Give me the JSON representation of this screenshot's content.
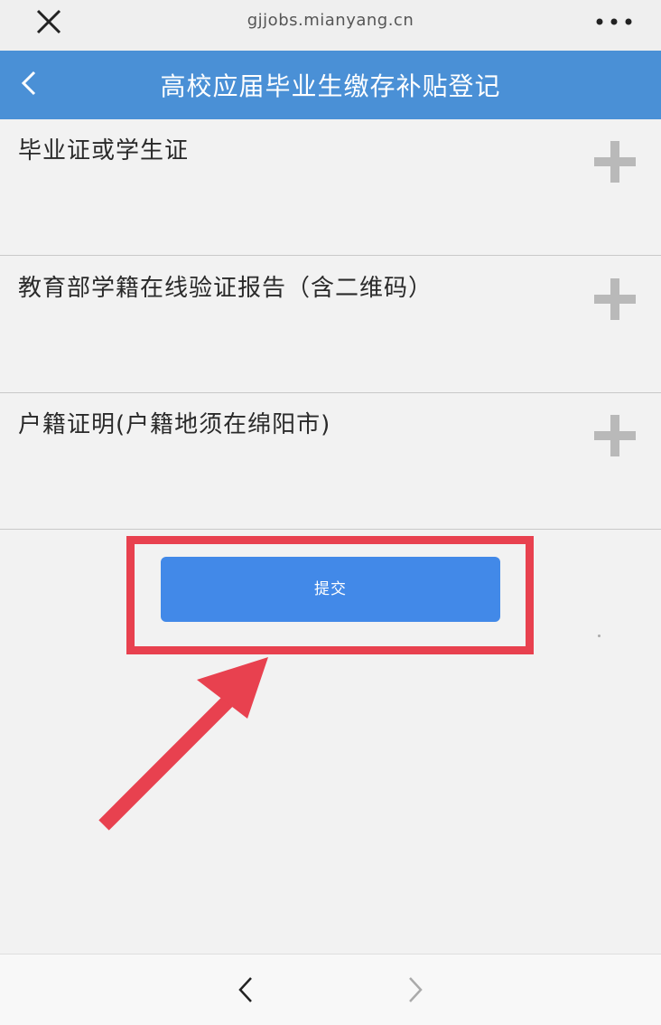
{
  "browser": {
    "url": "gjjobs.mianyang.cn",
    "close_icon": "close-icon",
    "more_icon": "more-dots-icon"
  },
  "header": {
    "title": "高校应届毕业生缴存补贴登记",
    "back_icon": "chevron-left-icon",
    "background": "#4a90d6"
  },
  "uploads": [
    {
      "label": "毕业证或学生证",
      "icon": "plus-icon"
    },
    {
      "label": "教育部学籍在线验证报告（含二维码）",
      "icon": "plus-icon"
    },
    {
      "label": "户籍证明(户籍地须在绵阳市)",
      "icon": "plus-icon"
    }
  ],
  "submit": {
    "label": "提交",
    "color": "#4289e8"
  },
  "annotation": {
    "color": "#e8414f"
  },
  "bottom_nav": {
    "back_icon": "chevron-left-icon",
    "forward_icon": "chevron-right-icon"
  }
}
